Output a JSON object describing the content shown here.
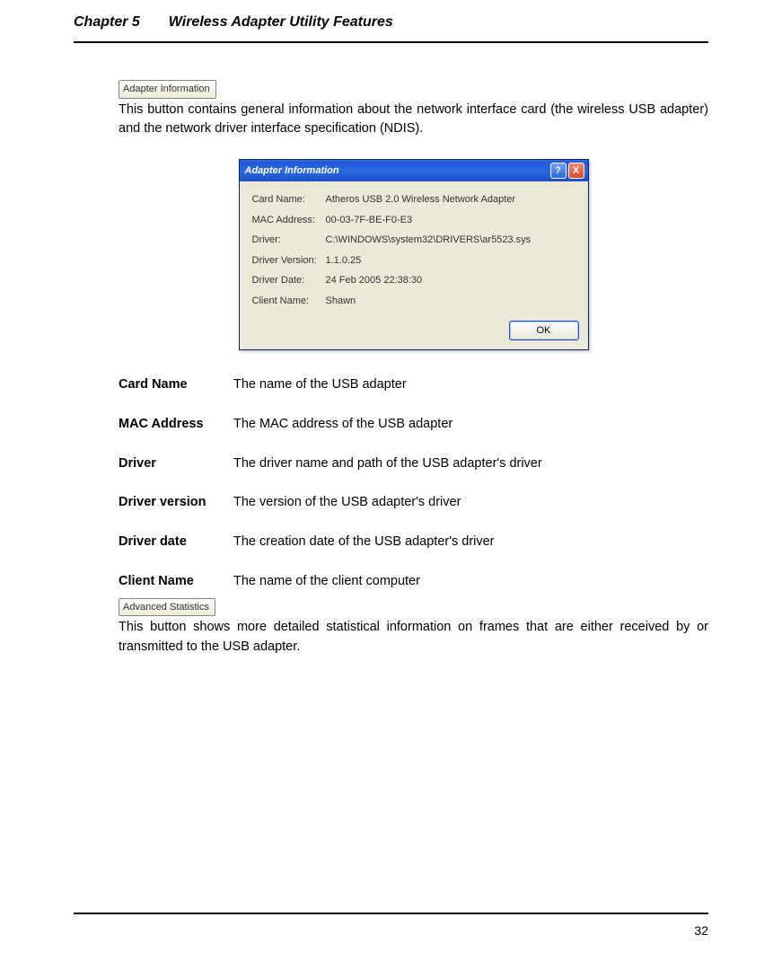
{
  "header": {
    "chapter": "Chapter 5",
    "title": "Wireless Adapter Utility Features"
  },
  "buttons": {
    "adapter_info": "Adapter Information",
    "advanced_stats": "Advanced Statistics"
  },
  "intro": "This button contains general information about the network interface card (the wireless USB adapter) and the network driver interface specification (NDIS).",
  "dialog": {
    "title": "Adapter Information",
    "rows": [
      {
        "label": "Card Name:",
        "value": "Atheros USB 2.0 Wireless Network Adapter"
      },
      {
        "label": "MAC Address:",
        "value": "00-03-7F-BE-F0-E3"
      },
      {
        "label": "Driver:",
        "value": "C:\\WINDOWS\\system32\\DRIVERS\\ar5523.sys"
      },
      {
        "label": "Driver Version:",
        "value": "1.1.0.25"
      },
      {
        "label": "Driver Date:",
        "value": "24 Feb 2005 22:38:30"
      },
      {
        "label": "Client Name:",
        "value": "Shawn"
      }
    ],
    "ok": "OK",
    "help": "?",
    "close": "X"
  },
  "definitions": [
    {
      "term": "Card Name",
      "desc": "The name of the USB adapter"
    },
    {
      "term": "MAC Address",
      "desc": "The MAC address of the USB adapter"
    },
    {
      "term": "Driver",
      "desc": "The driver name and path of the USB adapter's driver"
    },
    {
      "term": "Driver version",
      "desc": "The version of the USB adapter's driver"
    },
    {
      "term": "Driver date",
      "desc": "The creation date of the USB adapter's driver"
    },
    {
      "term": "Client Name",
      "desc": "The name of the client computer"
    }
  ],
  "stats_para": "This button shows more detailed statistical information on frames that are either received by or transmitted to the USB adapter.",
  "page_number": "32"
}
